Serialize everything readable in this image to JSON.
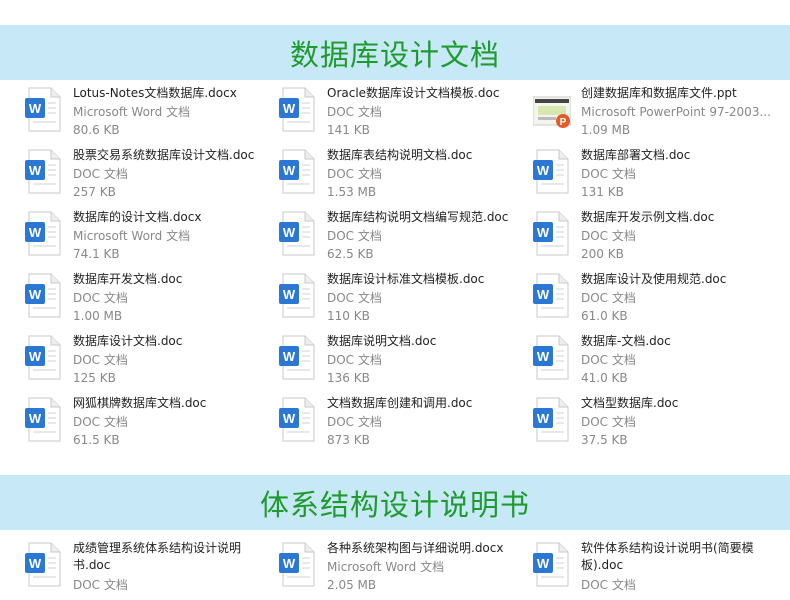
{
  "sections": [
    {
      "title": "数据库设计文档",
      "files": [
        {
          "name": "Lotus-Notes文档数据库.docx",
          "type": "Microsoft Word 文档",
          "size": "80.6 KB",
          "icon": "word-icon"
        },
        {
          "name": "Oracle数据库设计文档模板.doc",
          "type": "DOC 文档",
          "size": "141 KB",
          "icon": "word-icon"
        },
        {
          "name": "创建数据库和数据库文件.ppt",
          "type": "Microsoft PowerPoint 97-2003...",
          "size": "1.09 MB",
          "icon": "ppt-icon"
        },
        {
          "name": "股票交易系统数据库设计文档.doc",
          "type": "DOC 文档",
          "size": "257 KB",
          "icon": "word-icon"
        },
        {
          "name": "数据库表结构说明文档.doc",
          "type": "DOC 文档",
          "size": "1.53 MB",
          "icon": "word-icon"
        },
        {
          "name": "数据库部署文档.doc",
          "type": "DOC 文档",
          "size": "131 KB",
          "icon": "word-icon"
        },
        {
          "name": "数据库的设计文档.docx",
          "type": "Microsoft Word 文档",
          "size": "74.1 KB",
          "icon": "word-icon"
        },
        {
          "name": "数据库结构说明文档编写规范.doc",
          "type": "DOC 文档",
          "size": "62.5 KB",
          "icon": "word-icon"
        },
        {
          "name": "数据库开发示例文档.doc",
          "type": "DOC 文档",
          "size": "200 KB",
          "icon": "word-icon"
        },
        {
          "name": "数据库开发文档.doc",
          "type": "DOC 文档",
          "size": "1.00 MB",
          "icon": "word-icon"
        },
        {
          "name": "数据库设计标准文档模板.doc",
          "type": "DOC 文档",
          "size": "110 KB",
          "icon": "word-icon"
        },
        {
          "name": "数据库设计及使用规范.doc",
          "type": "DOC 文档",
          "size": "61.0 KB",
          "icon": "word-icon"
        },
        {
          "name": "数据库设计文档.doc",
          "type": "DOC 文档",
          "size": "125 KB",
          "icon": "word-icon"
        },
        {
          "name": "数据库说明文档.doc",
          "type": "DOC 文档",
          "size": "136 KB",
          "icon": "word-icon"
        },
        {
          "name": "数据库-文档.doc",
          "type": "DOC 文档",
          "size": "41.0 KB",
          "icon": "word-icon"
        },
        {
          "name": "网狐棋牌数据库文档.doc",
          "type": "DOC 文档",
          "size": "61.5 KB",
          "icon": "word-icon"
        },
        {
          "name": "文档数据库创建和调用.doc",
          "type": "DOC 文档",
          "size": "873 KB",
          "icon": "word-icon"
        },
        {
          "name": "文档型数据库.doc",
          "type": "DOC 文档",
          "size": "37.5 KB",
          "icon": "word-icon"
        }
      ]
    },
    {
      "title": "体系结构设计说明书",
      "files": [
        {
          "name": "成绩管理系统体系结构设计说明书.doc",
          "type": "DOC 文档",
          "size": "",
          "icon": "word-icon"
        },
        {
          "name": "各种系统架构图与详细说明.docx",
          "type": "Microsoft Word 文档",
          "size": "2.05 MB",
          "icon": "word-icon"
        },
        {
          "name": "软件体系结构设计说明书(简要模板).doc",
          "type": "DOC 文档",
          "size": "",
          "icon": "word-icon"
        }
      ]
    }
  ],
  "colors": {
    "banner_bg": "#c7e9f7",
    "banner_text": "#1f9a2e",
    "word_blue": "#2b78d4"
  }
}
